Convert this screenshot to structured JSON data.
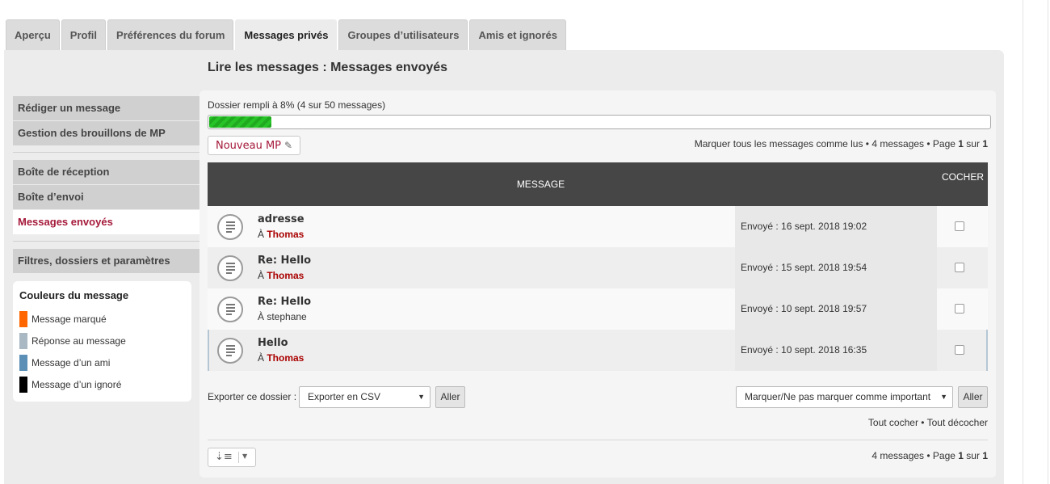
{
  "tabs": [
    {
      "label": "Aperçu"
    },
    {
      "label": "Profil"
    },
    {
      "label": "Préférences du forum"
    },
    {
      "label": "Messages privés"
    },
    {
      "label": "Groupes d’utilisateurs"
    },
    {
      "label": "Amis et ignorés"
    }
  ],
  "active_tab": "Messages privés",
  "page_title": "Lire les messages : Messages envoyés",
  "sidebar": {
    "group1": [
      {
        "label": "Rédiger un message"
      },
      {
        "label": "Gestion des brouillons de MP"
      }
    ],
    "group2": [
      {
        "label": "Boîte de réception"
      },
      {
        "label": "Boîte d’envoi"
      },
      {
        "label": "Messages envoyés"
      }
    ],
    "group3": [
      {
        "label": "Filtres, dossiers et paramètres"
      }
    ],
    "active_item": "Messages envoyés"
  },
  "legend": {
    "title": "Couleurs du message",
    "items": [
      {
        "label": "Message marqué",
        "color": "#ff6600"
      },
      {
        "label": "Réponse au message",
        "color": "#a9b8c2"
      },
      {
        "label": "Message d’un ami",
        "color": "#5c8fb5"
      },
      {
        "label": "Message d’un ignoré",
        "color": "#000000"
      }
    ]
  },
  "quota": {
    "text": "Dossier rempli à 8% (4 sur 50 messages)",
    "percent": 8
  },
  "new_pm_button": "Nouveau MP",
  "pen_icon": "pencil-icon",
  "pagination_top": {
    "mark_all": "Marquer tous les messages comme lus",
    "sep1": " • ",
    "count": "4 messages",
    "sep2": " • ",
    "page_prefix": "Page ",
    "page": "1",
    "of": " sur ",
    "total": "1"
  },
  "table": {
    "header_message": "MESSAGE",
    "header_mark": "COCHER",
    "to_prefix": "À ",
    "rows": [
      {
        "subject": "adresse",
        "recipient": "Thomas",
        "recipient_colored": true,
        "sent": "Envoyé : 16 sept. 2018 19:02"
      },
      {
        "subject": "Re: Hello",
        "recipient": "Thomas",
        "recipient_colored": true,
        "sent": "Envoyé : 15 sept. 2018 19:54"
      },
      {
        "subject": "Re: Hello",
        "recipient": "stephane",
        "recipient_colored": false,
        "sent": "Envoyé : 10 sept. 2018 19:57"
      },
      {
        "subject": "Hello",
        "recipient": "Thomas",
        "recipient_colored": true,
        "sent": "Envoyé : 10 sept. 2018 16:35"
      }
    ]
  },
  "export": {
    "label": "Exporter ce dossier :",
    "selected": "Exporter en CSV",
    "go": "Aller"
  },
  "mark_action": {
    "selected": "Marquer/Ne pas marquer comme important",
    "go": "Aller"
  },
  "check_links": {
    "check_all": "Tout cocher",
    "sep": " • ",
    "uncheck_all": "Tout décocher"
  },
  "pagination_bottom": {
    "count": "4 messages",
    "sep": " • ",
    "page_prefix": "Page ",
    "page": "1",
    "of": " sur ",
    "total": "1"
  }
}
